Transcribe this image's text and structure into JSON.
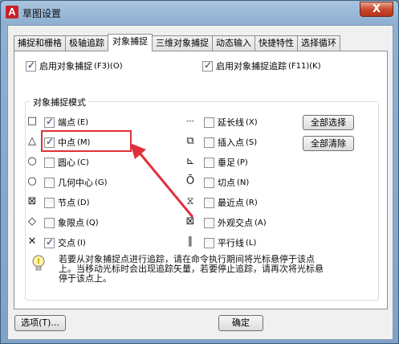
{
  "window": {
    "title": "草图设置",
    "close_glyph": "X"
  },
  "tabs": [
    {
      "label": "捕捉和栅格"
    },
    {
      "label": "极轴追踪"
    },
    {
      "label": "对象捕捉",
      "active": true
    },
    {
      "label": "三维对象捕捉"
    },
    {
      "label": "动态输入"
    },
    {
      "label": "快捷特性"
    },
    {
      "label": "选择循环"
    }
  ],
  "top_options": {
    "enable_osnap": {
      "label": "启用对象捕捉",
      "shortcut": "(F3)(O)",
      "checked": true
    },
    "enable_tracking": {
      "label": "启用对象捕捉追踪",
      "shortcut": "(F11)(K)",
      "checked": true
    }
  },
  "group_title": "对象捕捉模式",
  "modes_left": [
    {
      "symbol": "□",
      "label": "端点",
      "key": "(E)",
      "checked": true
    },
    {
      "symbol": "△",
      "label": "中点",
      "key": "(M)",
      "checked": true
    },
    {
      "symbol": "○",
      "label": "圆心",
      "key": "(C)",
      "checked": false
    },
    {
      "symbol": "○",
      "label": "几何中心",
      "key": "(G)",
      "checked": false
    },
    {
      "symbol": "⊠",
      "label": "节点",
      "key": "(D)",
      "checked": false
    },
    {
      "symbol": "◇",
      "label": "象限点",
      "key": "(Q)",
      "checked": false
    },
    {
      "symbol": "✕",
      "label": "交点",
      "key": "(I)",
      "checked": true
    }
  ],
  "modes_right": [
    {
      "symbol": "---",
      "label": "延长线",
      "key": "(X)",
      "checked": false
    },
    {
      "symbol": "⧉",
      "label": "插入点",
      "key": "(S)",
      "checked": false
    },
    {
      "symbol": "⊾",
      "label": "垂足",
      "key": "(P)",
      "checked": false
    },
    {
      "symbol": "Ō",
      "label": "切点",
      "key": "(N)",
      "checked": false
    },
    {
      "symbol": "⧖",
      "label": "最近点",
      "key": "(R)",
      "checked": false
    },
    {
      "symbol": "⊠",
      "label": "外观交点",
      "key": "(A)",
      "checked": false
    },
    {
      "symbol": "∥",
      "label": "平行线",
      "key": "(L)",
      "checked": false
    }
  ],
  "buttons": {
    "select_all": "全部选择",
    "clear_all": "全部清除"
  },
  "hint_text": "若要从对象捕捉点进行追踪，请在命令执行期间将光标悬停于该点上。当移动光标时会出现追踪矢量，若要停止追踪，请再次将光标悬停于该点上。",
  "footer": {
    "options_button": "选项(T)...",
    "ok_button": "确定"
  },
  "colors": {
    "highlight": "#e0303a",
    "arrow": "#e0303a",
    "window_frame": "#8fb0d1"
  }
}
